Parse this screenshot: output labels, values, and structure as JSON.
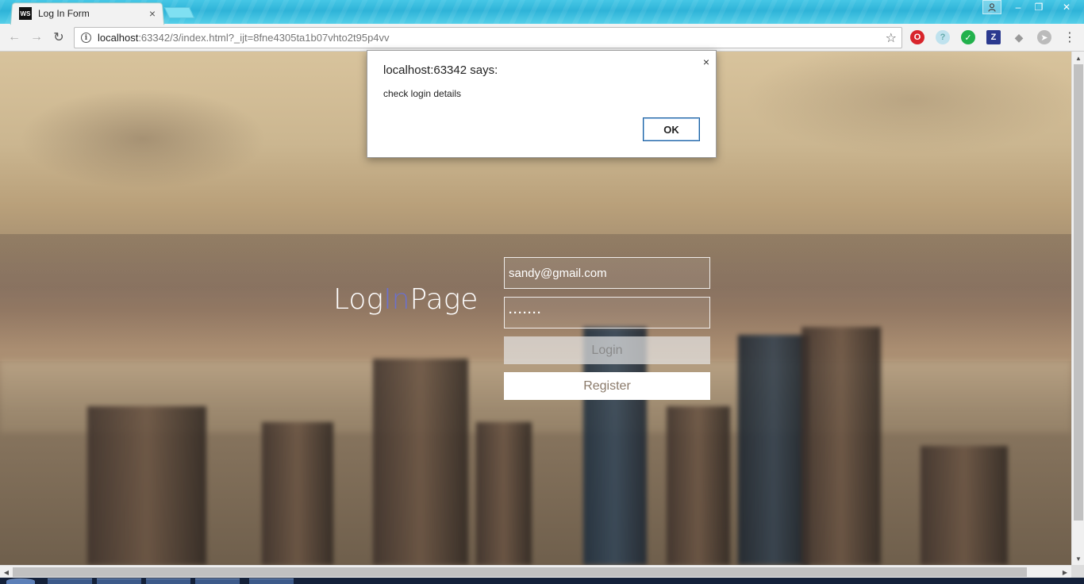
{
  "browser": {
    "tab_title": "Log In Form",
    "tab_favicon": "WS",
    "url_host": "localhost",
    "url_rest": ":63342/3/index.html?_ijt=8fne4305ta1b07vhto2t95p4vv",
    "close_glyph": "×",
    "window_controls": {
      "minimize": "–",
      "restore": "❐",
      "close": "✕"
    },
    "extensions": [
      "opera-icon",
      "help-icon",
      "check-icon",
      "z-icon",
      "diamond-icon",
      "compass-icon"
    ],
    "colors": {
      "titlebar": "#2eb3d8",
      "toolbar": "#f2f2f2"
    }
  },
  "page": {
    "brand_left": "Log",
    "brand_mid": "In",
    "brand_right": "Page",
    "email_value": "sandy@gmail.com",
    "password_value": "·······",
    "login_label": "Login",
    "register_label": "Register",
    "accent_color": "#6d71c9"
  },
  "dialog": {
    "title": "localhost:63342 says:",
    "message": "check login details",
    "ok_label": "OK",
    "close_glyph": "×"
  }
}
